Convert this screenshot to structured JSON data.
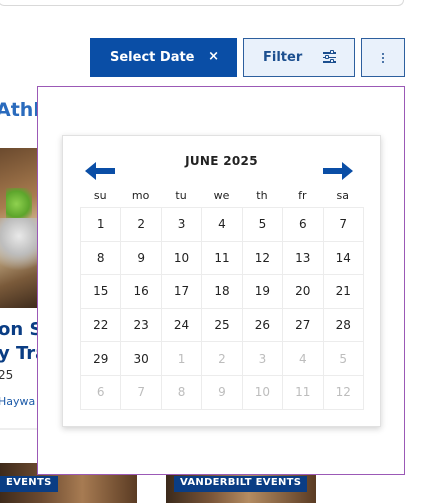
{
  "toolbar": {
    "select_date_label": "Select Date",
    "clear_glyph": "×",
    "filter_label": "Filter",
    "more_icon": "vertical-ellipsis-icon",
    "filter_icon": "sliders-icon"
  },
  "background": {
    "heading_fragment": "Athl",
    "card": {
      "title_line1": "on S",
      "title_line2": "y Tra",
      "subtitle": "25",
      "location": "Haywa"
    },
    "tags": [
      "EVENTS",
      "VANDERBILT EVENTS"
    ]
  },
  "calendar": {
    "month_label": "JUNE 2025",
    "prev_icon": "arrow-left-icon",
    "next_icon": "arrow-right-icon",
    "weekdays": [
      "su",
      "mo",
      "tu",
      "we",
      "th",
      "fr",
      "sa"
    ],
    "weeks": [
      [
        {
          "d": "1",
          "m": false
        },
        {
          "d": "2",
          "m": false
        },
        {
          "d": "3",
          "m": false
        },
        {
          "d": "4",
          "m": false
        },
        {
          "d": "5",
          "m": false
        },
        {
          "d": "6",
          "m": false
        },
        {
          "d": "7",
          "m": false
        }
      ],
      [
        {
          "d": "8",
          "m": false
        },
        {
          "d": "9",
          "m": false
        },
        {
          "d": "10",
          "m": false
        },
        {
          "d": "11",
          "m": false
        },
        {
          "d": "12",
          "m": false
        },
        {
          "d": "13",
          "m": false
        },
        {
          "d": "14",
          "m": false
        }
      ],
      [
        {
          "d": "15",
          "m": false
        },
        {
          "d": "16",
          "m": false
        },
        {
          "d": "17",
          "m": false
        },
        {
          "d": "18",
          "m": false
        },
        {
          "d": "19",
          "m": false
        },
        {
          "d": "20",
          "m": false
        },
        {
          "d": "21",
          "m": false
        }
      ],
      [
        {
          "d": "22",
          "m": false
        },
        {
          "d": "23",
          "m": false
        },
        {
          "d": "24",
          "m": false
        },
        {
          "d": "25",
          "m": false
        },
        {
          "d": "26",
          "m": false
        },
        {
          "d": "27",
          "m": false
        },
        {
          "d": "28",
          "m": false
        }
      ],
      [
        {
          "d": "29",
          "m": false
        },
        {
          "d": "30",
          "m": false
        },
        {
          "d": "1",
          "m": true
        },
        {
          "d": "2",
          "m": true
        },
        {
          "d": "3",
          "m": true
        },
        {
          "d": "4",
          "m": true
        },
        {
          "d": "5",
          "m": true
        }
      ],
      [
        {
          "d": "6",
          "m": true
        },
        {
          "d": "7",
          "m": true
        },
        {
          "d": "8",
          "m": true
        },
        {
          "d": "9",
          "m": true
        },
        {
          "d": "10",
          "m": true
        },
        {
          "d": "11",
          "m": true
        },
        {
          "d": "12",
          "m": true
        }
      ]
    ]
  },
  "colors": {
    "primary": "#0a4ea6",
    "secondary_bg": "#e9f1fb",
    "popover_border": "#9b59b6",
    "muted_day": "#bdbdbd"
  }
}
